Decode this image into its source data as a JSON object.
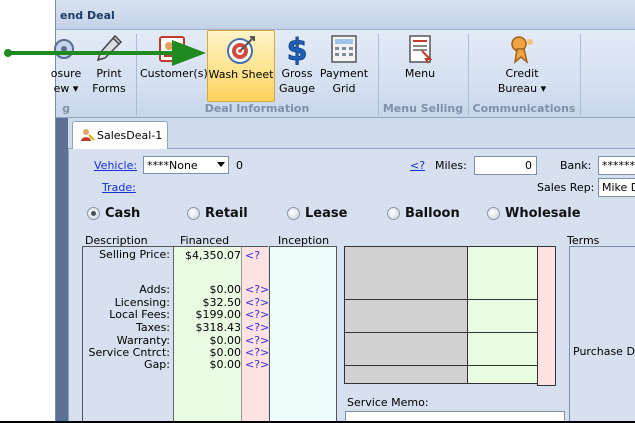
{
  "window": {
    "title": "end Deal"
  },
  "ribbon": {
    "buttons": [
      {
        "id": "closure",
        "label_line1": "osure",
        "label_line2": "ew ▾"
      },
      {
        "id": "print-forms",
        "label_line1": "Print",
        "label_line2": "Forms"
      },
      {
        "id": "customers",
        "label_line1": "Customer(s)",
        "label_line2": ""
      },
      {
        "id": "wash-sheet",
        "label_line1": "Wash Sheet",
        "label_line2": ""
      },
      {
        "id": "gross-gauge",
        "label_line1": "Gross",
        "label_line2": "Gauge"
      },
      {
        "id": "payment-grid",
        "label_line1": "Payment",
        "label_line2": "Grid"
      },
      {
        "id": "menu",
        "label_line1": "Menu",
        "label_line2": ""
      },
      {
        "id": "credit-bureau",
        "label_line1": "Credit",
        "label_line2": "Bureau ▾"
      }
    ],
    "groups": {
      "g0": "g",
      "deal_information": "Deal Information",
      "menu_selling": "Menu Selling",
      "communications": "Communications"
    }
  },
  "tabs": [
    {
      "label": "SalesDeal-1"
    }
  ],
  "form": {
    "vehicle_label": "Vehicle:",
    "vehicle_value": "****None",
    "vehicle_count": "0",
    "trade_label": "Trade:",
    "query_link": "<?",
    "miles_label": "Miles:",
    "miles_value": "0",
    "bank_label": "Bank:",
    "bank_value": "******",
    "sales_rep_label": "Sales Rep:",
    "sales_rep_value": "Mike Do",
    "deal_types": [
      {
        "label": "Cash",
        "selected": true
      },
      {
        "label": "Retail",
        "selected": false
      },
      {
        "label": "Lease",
        "selected": false
      },
      {
        "label": "Balloon",
        "selected": false
      },
      {
        "label": "Wholesale",
        "selected": false
      }
    ],
    "columns": {
      "description": "Description",
      "financed": "Financed",
      "inception": "Inception",
      "terms": "Terms"
    },
    "rows": [
      {
        "label": "Selling Price:",
        "financed": "$4,350.07",
        "q": "<?"
      },
      {
        "label": "Adds:",
        "financed": "$0.00",
        "q": "<?>"
      },
      {
        "label": "Licensing:",
        "financed": "$32.50",
        "q": "<?>"
      },
      {
        "label": "Local Fees:",
        "financed": "$199.00",
        "q": "<?>"
      },
      {
        "label": "Taxes:",
        "financed": "$318.43",
        "q": "<?>"
      },
      {
        "label": "Warranty:",
        "financed": "$0.00",
        "q": "<?>"
      },
      {
        "label": "Service Cntrct:",
        "financed": "$0.00",
        "q": "<?>"
      },
      {
        "label": "Gap:",
        "financed": "$0.00",
        "q": "<?>"
      }
    ],
    "service_memo_label": "Service Memo:",
    "purchase_date_label": "Purchase Da"
  },
  "colors": {
    "financed_bg": "#eafbe4",
    "pink_bg": "#ffe3e3",
    "inception_bg": "#eefcfc",
    "grid_gray": "#d2d2d2",
    "arrow_green": "#1f8a1f"
  }
}
